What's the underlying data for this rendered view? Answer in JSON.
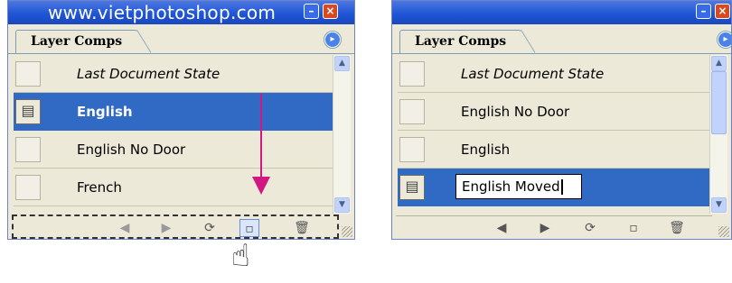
{
  "watermark": "www.vietphotoshop.com",
  "left_panel": {
    "tab_label": "Layer Comps",
    "rows": [
      {
        "label": "Last Document State",
        "italic": true,
        "selected": false,
        "applied": false
      },
      {
        "label": "English",
        "italic": false,
        "selected": true,
        "applied": true
      },
      {
        "label": "English No Door",
        "italic": false,
        "selected": false,
        "applied": false
      },
      {
        "label": "French",
        "italic": false,
        "selected": false,
        "applied": false
      }
    ],
    "highlighted_button": "create-new-layer-comp"
  },
  "right_panel": {
    "tab_label": "Layer Comps",
    "rows": [
      {
        "label": "Last Document State",
        "italic": true,
        "selected": false,
        "applied": false
      },
      {
        "label": "English No Door",
        "italic": false,
        "selected": false,
        "applied": false
      },
      {
        "label": "English",
        "italic": false,
        "selected": false,
        "applied": false
      },
      {
        "label": "",
        "italic": false,
        "selected": true,
        "applied": true,
        "editing_value": "English Moved"
      }
    ]
  },
  "colors": {
    "panel_bg": "#ece9d8",
    "selection": "#316ac5",
    "titlebar": "#1f55d6",
    "arrow": "#d01880"
  },
  "icons": {
    "applied_comp": "layer-comp-applied-icon",
    "previous": "previous-comp-triangle",
    "next": "next-comp-triangle",
    "update": "update-comp-icon",
    "new": "create-new-comp-icon",
    "delete": "trash-icon",
    "cursor": "hand-pointer"
  }
}
